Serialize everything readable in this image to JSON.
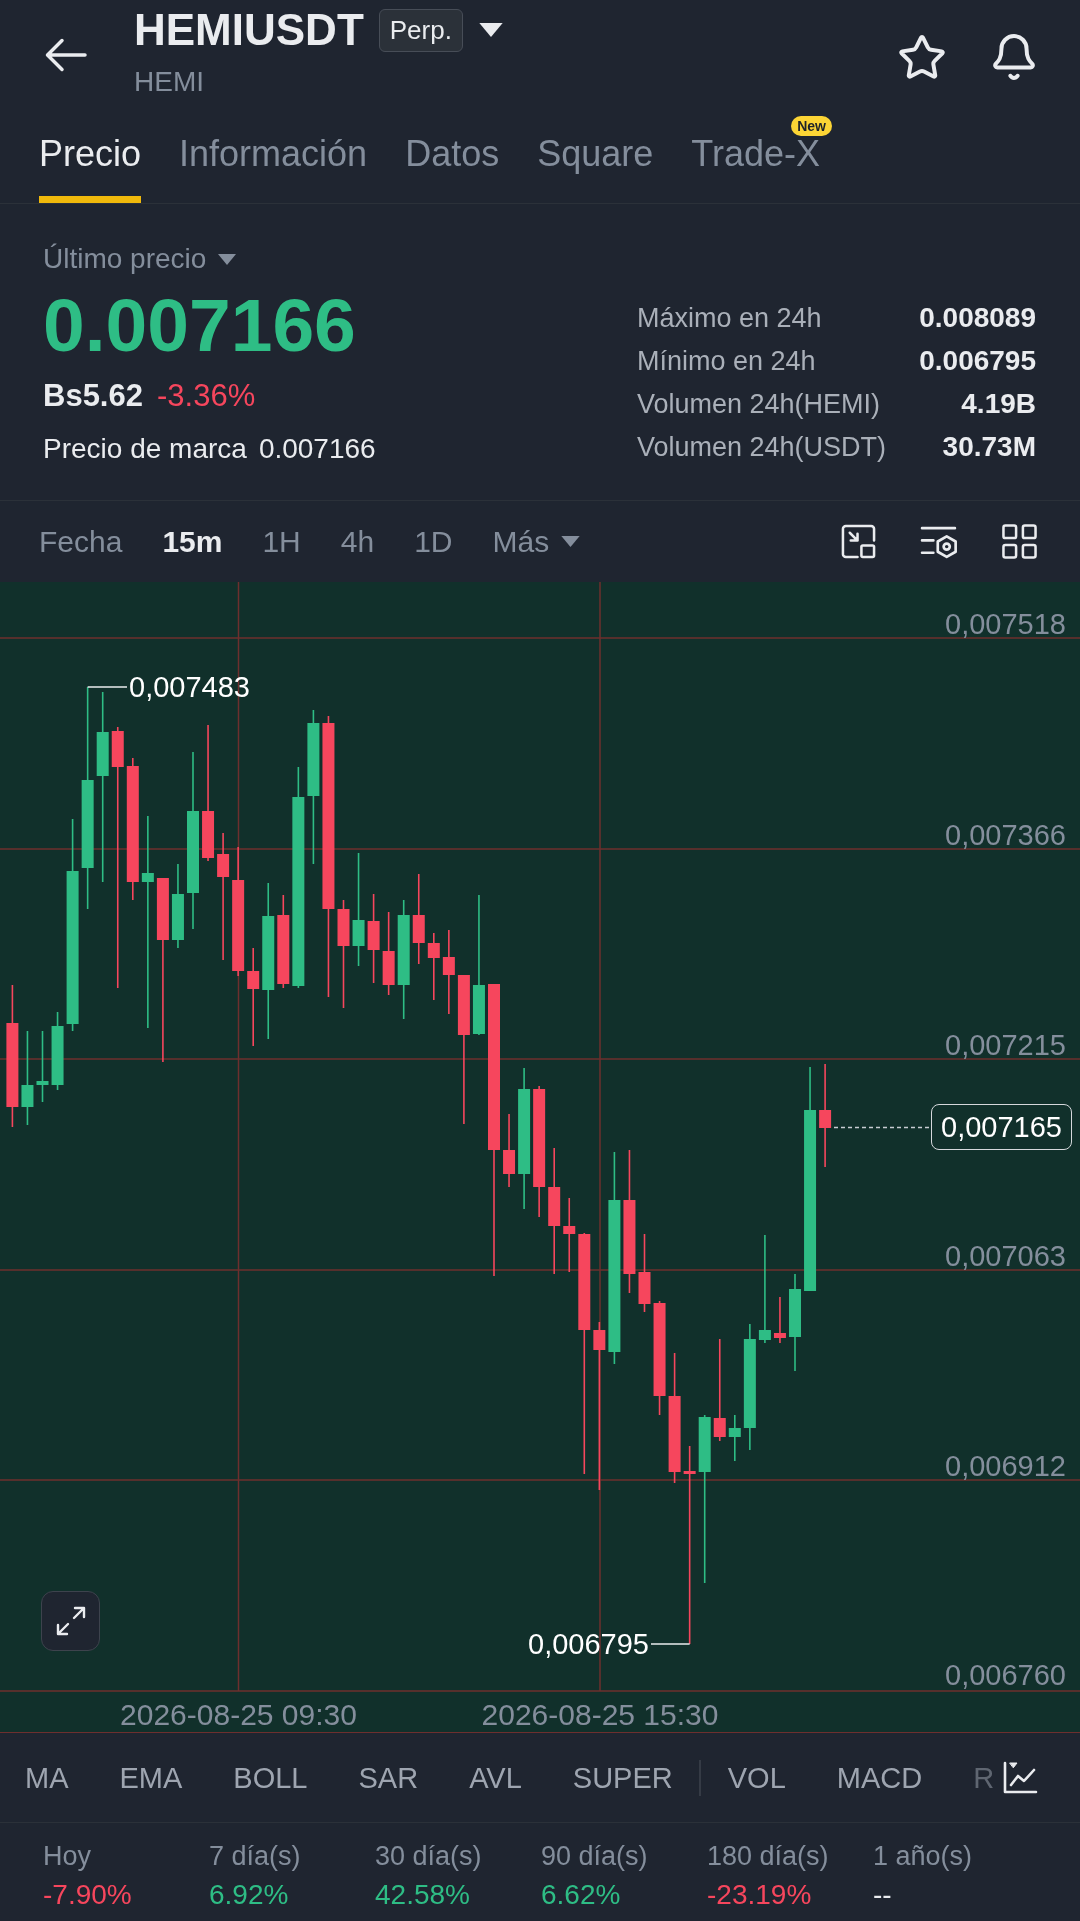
{
  "header": {
    "symbol": "HEMIUSDT",
    "contract_badge": "Perp.",
    "base_asset": "HEMI"
  },
  "tabs": [
    {
      "label": "Precio",
      "selected": true
    },
    {
      "label": "Información",
      "selected": false
    },
    {
      "label": "Datos",
      "selected": false
    },
    {
      "label": "Square",
      "selected": false
    },
    {
      "label": "Trade-X",
      "selected": false,
      "badge": "New"
    }
  ],
  "price": {
    "label": "Último precio",
    "last": "0.007166",
    "fiat": "Bs5.62",
    "change": "-3.36%",
    "mark_label": "Precio de marca",
    "mark_value": "0.007166"
  },
  "stats": [
    {
      "label": "Máximo en 24h",
      "value": "0.008089"
    },
    {
      "label": "Mínimo en 24h",
      "value": "0.006795"
    },
    {
      "label": "Volumen 24h(HEMI)",
      "value": "4.19B"
    },
    {
      "label": "Volumen 24h(USDT)",
      "value": "30.73M"
    }
  ],
  "intervals": [
    {
      "label": "Fecha",
      "kind": "option",
      "selected": false
    },
    {
      "label": "15m",
      "kind": "option",
      "selected": true
    },
    {
      "label": "1H",
      "kind": "option",
      "selected": false
    },
    {
      "label": "4h",
      "kind": "option",
      "selected": false
    },
    {
      "label": "1D",
      "kind": "option",
      "selected": false
    },
    {
      "label": "Más",
      "kind": "dropdown",
      "selected": false
    }
  ],
  "chart": {
    "price_axis": [
      "0,007518",
      "0,007366",
      "0,007215",
      "0,007063",
      "0,006912",
      "0,006760"
    ],
    "time_axis": [
      "2026-08-25 09:30",
      "2026-08-25 15:30"
    ],
    "high_label": "0,007483",
    "low_label": "0,006795",
    "current_price": "0,007165"
  },
  "indicators": {
    "main": [
      "MA",
      "EMA",
      "BOLL",
      "SAR",
      "AVL",
      "SUPER"
    ],
    "sub": [
      "VOL",
      "MACD",
      "R"
    ]
  },
  "periods": [
    {
      "label": "Hoy",
      "value": "-7.90%",
      "color": "#f6465d"
    },
    {
      "label": "7 día(s)",
      "value": "6.92%",
      "color": "#2ebd85"
    },
    {
      "label": "30 día(s)",
      "value": "42.58%",
      "color": "#2ebd85"
    },
    {
      "label": "90 día(s)",
      "value": "6.62%",
      "color": "#2ebd85"
    },
    {
      "label": "180 día(s)",
      "value": "-23.19%",
      "color": "#f6465d"
    },
    {
      "label": "1 año(s)",
      "value": "--",
      "color": "#eaecef"
    }
  ]
}
